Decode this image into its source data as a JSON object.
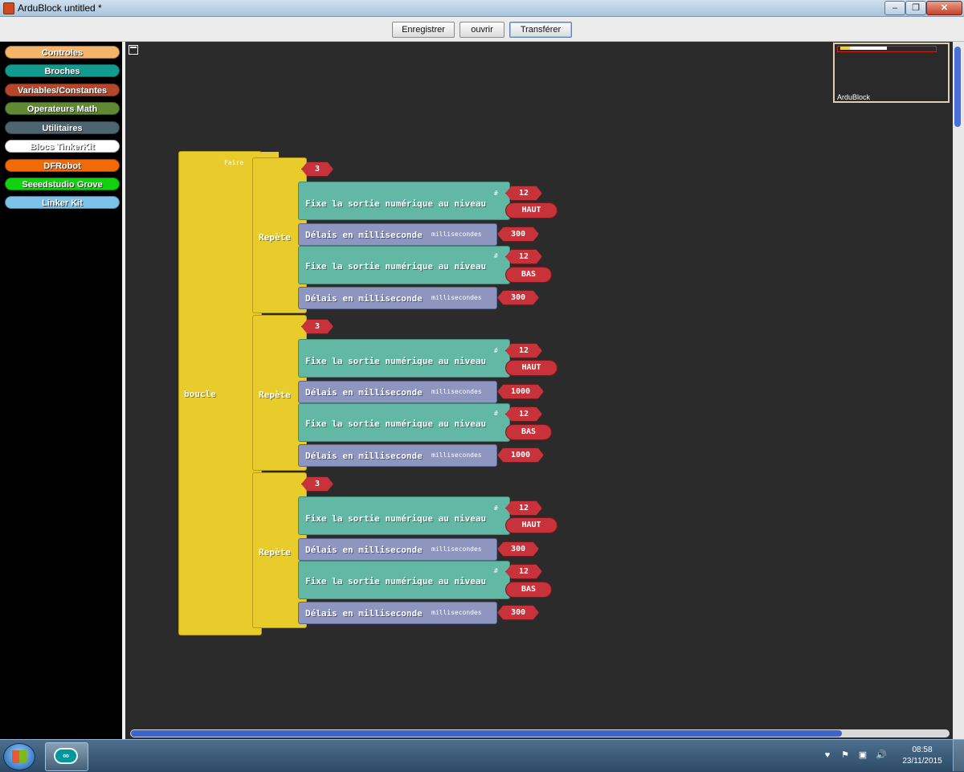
{
  "window": {
    "title": "ArduBlock untitled *",
    "controls": [
      "‒",
      "❐",
      "✕"
    ]
  },
  "toolbar": {
    "save": "Enregistrer",
    "open": "ouvrir",
    "upload": "Transférer"
  },
  "palette": [
    {
      "label": "Controles",
      "color": "#f5b469"
    },
    {
      "label": "Broches",
      "color": "#14998f"
    },
    {
      "label": "Variables/Constantes",
      "color": "#b5462a"
    },
    {
      "label": "Operateurs Math",
      "color": "#5f8a33"
    },
    {
      "label": "Utilitaires",
      "color": "#4d6570"
    },
    {
      "label": "Blocs TinkerKit",
      "color": "#ffffff"
    },
    {
      "label": "DFRobot",
      "color": "#f06a0a"
    },
    {
      "label": "Seeedstudio Grove",
      "color": "#12d10f"
    },
    {
      "label": "Linker Kit",
      "color": "#7cc2e8"
    }
  ],
  "minimap": {
    "label": "ArduBlock"
  },
  "program": {
    "loop_label": "boucle",
    "do_label": "Faire",
    "repeats": [
      {
        "label": "Repète",
        "count": "3",
        "set1": {
          "label": "Fixe la sortie numérique au niveau",
          "hash": "#",
          "pin": "12",
          "level": "HAUT"
        },
        "delay1": {
          "label": "Délais en milliseconde",
          "unit": "millisecondes",
          "value": "300"
        },
        "set2": {
          "label": "Fixe la sortie numérique au niveau",
          "hash": "#",
          "pin": "12",
          "level": "BAS"
        },
        "delay2": {
          "label": "Délais en milliseconde",
          "unit": "millisecondes",
          "value": "300"
        }
      },
      {
        "label": "Repète",
        "count": "3",
        "set1": {
          "label": "Fixe la sortie numérique au niveau",
          "hash": "#",
          "pin": "12",
          "level": "HAUT"
        },
        "delay1": {
          "label": "Délais en milliseconde",
          "unit": "millisecondes",
          "value": "1000"
        },
        "set2": {
          "label": "Fixe la sortie numérique au niveau",
          "hash": "#",
          "pin": "12",
          "level": "BAS"
        },
        "delay2": {
          "label": "Délais en milliseconde",
          "unit": "millisecondes",
          "value": "1000"
        }
      },
      {
        "label": "Repète",
        "count": "3",
        "set1": {
          "label": "Fixe la sortie numérique au niveau",
          "hash": "#",
          "pin": "12",
          "level": "HAUT"
        },
        "delay1": {
          "label": "Délais en milliseconde",
          "unit": "millisecondes",
          "value": "300"
        },
        "set2": {
          "label": "Fixe la sortie numérique au niveau",
          "hash": "#",
          "pin": "12",
          "level": "BAS"
        },
        "delay2": {
          "label": "Délais en milliseconde",
          "unit": "millisecondes",
          "value": "300"
        }
      }
    ]
  },
  "taskbar": {
    "app": "∞",
    "time": "08:58",
    "date": "23/11/2015",
    "tray": [
      "♥",
      "⚑",
      "▣",
      "🔊"
    ]
  }
}
